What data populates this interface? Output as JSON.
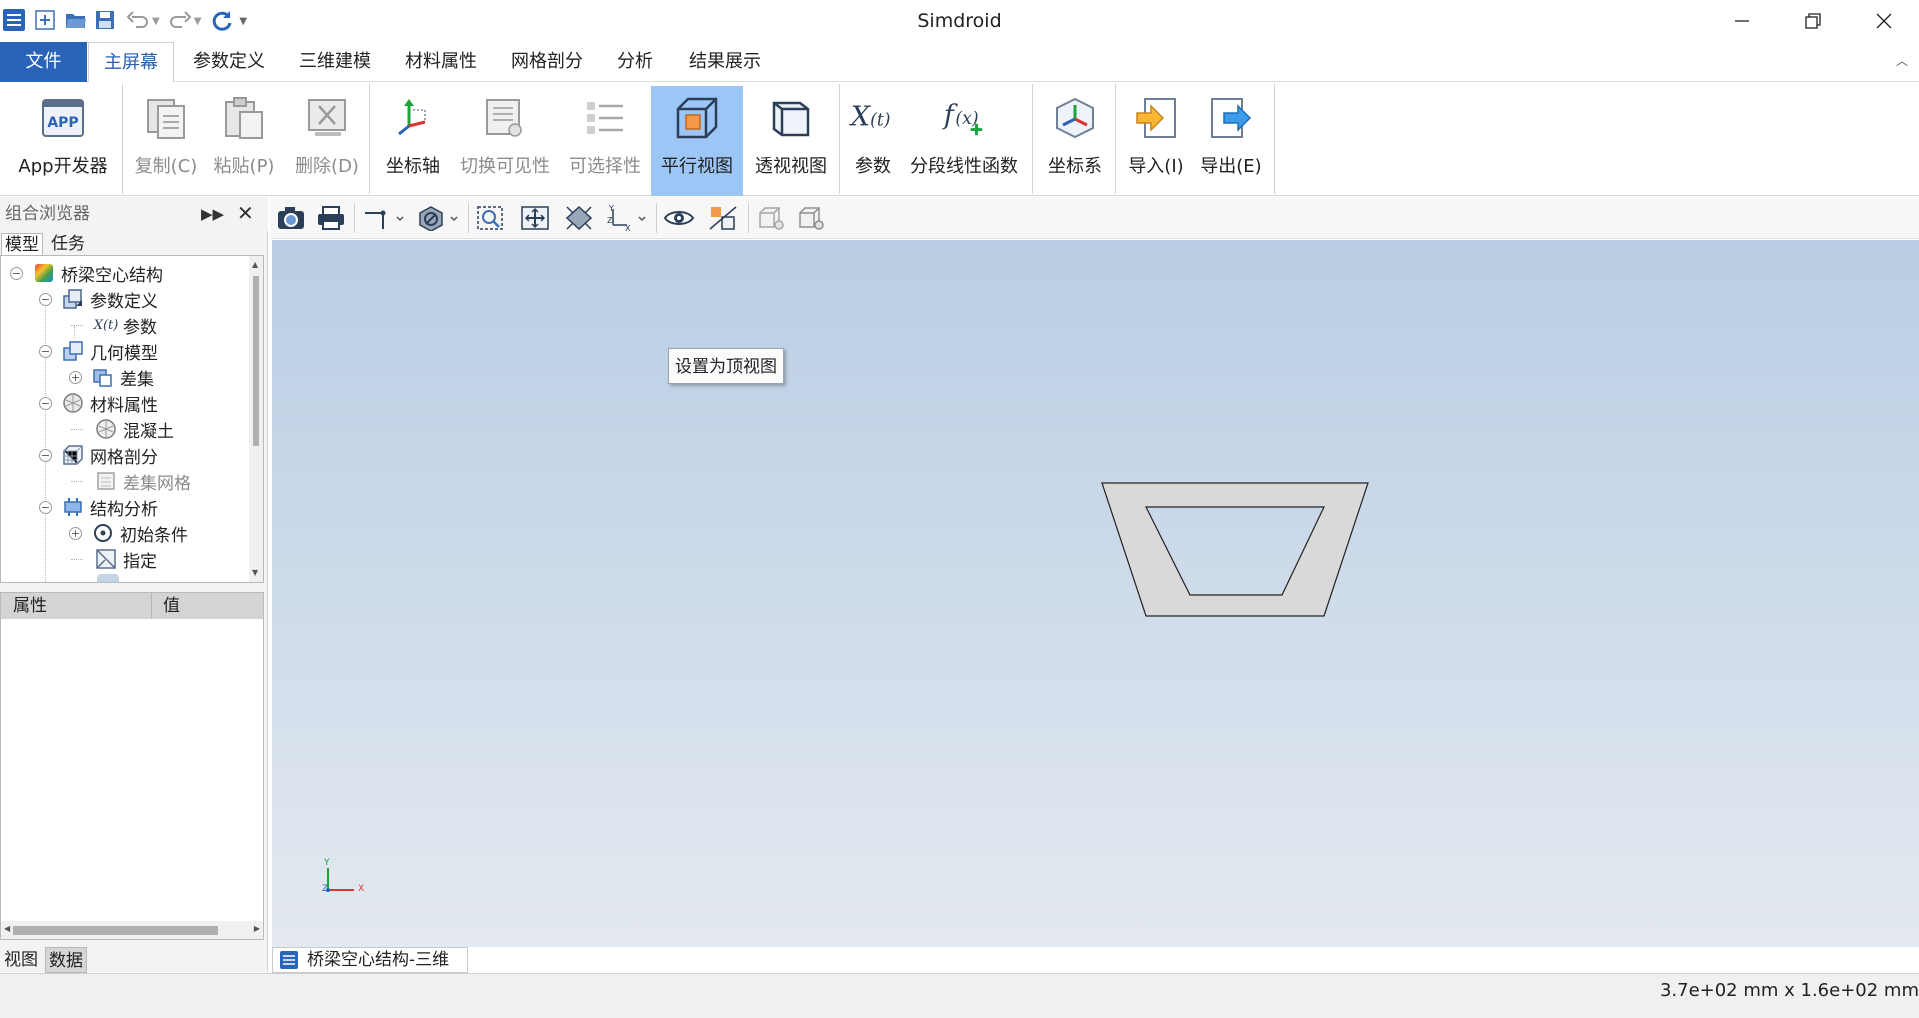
{
  "app": {
    "title": "Simdroid"
  },
  "menu": {
    "tabs": [
      "文件",
      "主屏幕",
      "参数定义",
      "三维建模",
      "材料属性",
      "网格剖分",
      "分析",
      "结果展示"
    ]
  },
  "ribbon": {
    "app_dev": "App开发器",
    "copy": "复制(C)",
    "paste": "粘贴(P)",
    "delete": "删除(D)",
    "axis": "坐标轴",
    "toggle_visibility": "切换可见性",
    "selectability": "可选择性",
    "parallel_view": "平行视图",
    "perspective_view": "透视视图",
    "parameter": "参数",
    "piecewise_linear": "分段线性函数",
    "coord_system": "坐标系",
    "import": "导入(I)",
    "export": "导出(E)",
    "app_icon_text": "APP"
  },
  "browser": {
    "title": "组合浏览器",
    "tab_model": "模型",
    "tab_task": "任务",
    "tree": [
      {
        "label": "桥梁空心结构",
        "level": 0,
        "expander": "−"
      },
      {
        "label": "参数定义",
        "level": 1,
        "expander": "−"
      },
      {
        "label": "参数",
        "level": 2,
        "expander": ""
      },
      {
        "label": "几何模型",
        "level": 1,
        "expander": "−"
      },
      {
        "label": "差集",
        "level": 2,
        "expander": "+"
      },
      {
        "label": "材料属性",
        "level": 1,
        "expander": "−"
      },
      {
        "label": "混凝土",
        "level": 2,
        "expander": ""
      },
      {
        "label": "网格剖分",
        "level": 1,
        "expander": "−"
      },
      {
        "label": "差集网格",
        "level": 2,
        "expander": ""
      },
      {
        "label": "结构分析",
        "level": 1,
        "expander": "−"
      },
      {
        "label": "初始条件",
        "level": 2,
        "expander": "+"
      },
      {
        "label": "指定",
        "level": 2,
        "expander": ""
      }
    ],
    "props_header_name": "属性",
    "props_header_value": "值",
    "bottom_tab_view": "视图",
    "bottom_tab_data": "数据"
  },
  "viewport": {
    "tooltip": "设置为顶视图",
    "axis_y": "Y",
    "axis_x": "X",
    "axis_z": "Z"
  },
  "document_tab": "桥梁空心结构-三维",
  "status": {
    "dimensions": "3.7e+02 mm x 1.6e+02 mm"
  },
  "colors": {
    "accent": "#2a64b8",
    "selected": "#9cc6f6",
    "shape_fill": "#d9d9d9"
  }
}
